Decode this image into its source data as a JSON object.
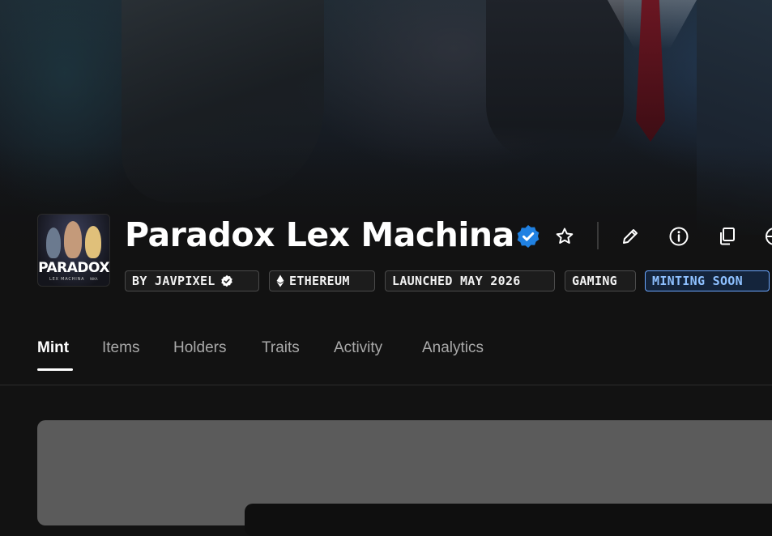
{
  "collection": {
    "title": "Paradox Lex Machina",
    "avatar_text": "PARADOX",
    "avatar_subtext": "LEX MACHINA",
    "avatar_mark": "NIKA"
  },
  "tags": [
    {
      "label": "BY JAVPIXEL",
      "icon": "verified-check-icon"
    },
    {
      "label": "ETHEREUM",
      "icon": "ethereum-icon"
    },
    {
      "label": "LAUNCHED MAY 2026"
    },
    {
      "label": "GAMING"
    },
    {
      "label": "MINTING SOON",
      "status": true
    }
  ],
  "actions": [
    "star-icon",
    "pencil-icon",
    "info-icon",
    "copy-icon",
    "globe-icon"
  ],
  "tabs": [
    {
      "label": "Mint",
      "active": true
    },
    {
      "label": "Items"
    },
    {
      "label": "Holders"
    },
    {
      "label": "Traits"
    },
    {
      "label": "Activity"
    },
    {
      "label": "Analytics"
    }
  ],
  "colors": {
    "background": "#121212",
    "verified": "#2081e2",
    "status_accent": "#6aa6ff",
    "panel": "#5b5b5b"
  }
}
